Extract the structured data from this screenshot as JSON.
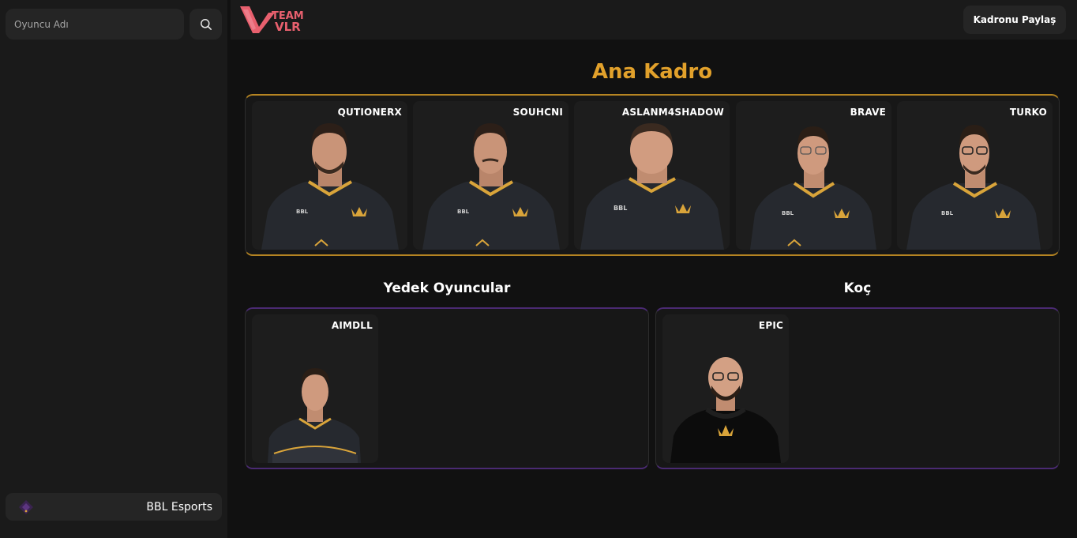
{
  "sidebar": {
    "search_placeholder": "Oyuncu Adı",
    "team_name": "BBL Esports"
  },
  "header": {
    "logo_text_line1": "TEAM",
    "logo_text_line2": "VLR",
    "share_label": "Kadronu Paylaş"
  },
  "main_roster": {
    "title": "Ana Kadro",
    "players": [
      {
        "name": "QUTIONERX"
      },
      {
        "name": "SOUHCNI"
      },
      {
        "name": "ASLANM4SHADOW"
      },
      {
        "name": "BRAVE"
      },
      {
        "name": "TURKO"
      }
    ]
  },
  "substitutes": {
    "title": "Yedek Oyuncular",
    "players": [
      {
        "name": "AIMDLL"
      }
    ]
  },
  "coach": {
    "title": "Koç",
    "players": [
      {
        "name": "EPIC"
      }
    ]
  },
  "colors": {
    "accent_gold": "#e2a12b",
    "logo_pink": "#e8606e",
    "jersey": "#26292f",
    "jersey_trim": "#d9a43a"
  }
}
